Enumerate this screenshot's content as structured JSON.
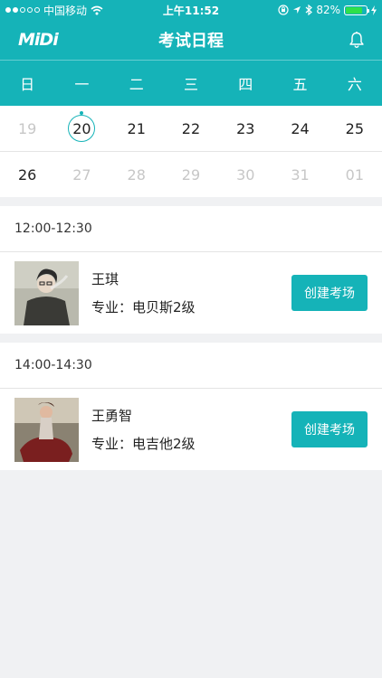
{
  "status_bar": {
    "carrier": "中国移动",
    "time": "上午11:52",
    "battery_percent": "82%",
    "battery_level": 0.82
  },
  "header": {
    "logo_text": "MiDi",
    "title": "考试日程",
    "notification_icon": "bell-icon"
  },
  "weekdays": [
    "日",
    "一",
    "二",
    "三",
    "四",
    "五",
    "六"
  ],
  "calendar": {
    "week1": [
      "19",
      "20",
      "21",
      "22",
      "23",
      "24",
      "25"
    ],
    "week2": [
      "26",
      "27",
      "28",
      "29",
      "30",
      "31",
      "01"
    ]
  },
  "schedule": [
    {
      "time": "12:00-12:30",
      "name": "王琪",
      "major": "专业：电贝斯2级",
      "button": "创建考场"
    },
    {
      "time": "14:00-14:30",
      "name": "王勇智",
      "major": "专业：电吉他2级",
      "button": "创建考场"
    }
  ],
  "colors": {
    "accent": "#15b3b8",
    "background": "#f0f1f3"
  }
}
